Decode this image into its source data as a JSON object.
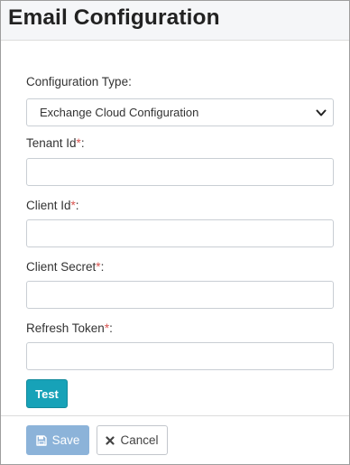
{
  "dialog": {
    "title": "Email Configuration"
  },
  "form": {
    "config_type": {
      "label": "Configuration Type:",
      "selected": "Exchange Cloud Configuration",
      "icon": "chevron-down-icon"
    },
    "tenant_id": {
      "label": "Tenant Id",
      "required_mark": "*",
      "suffix": ":",
      "value": ""
    },
    "client_id": {
      "label": "Client Id",
      "required_mark": "*",
      "suffix": ":",
      "value": ""
    },
    "client_secret": {
      "label": "Client Secret",
      "required_mark": "*",
      "suffix": ":",
      "value": ""
    },
    "refresh_token": {
      "label": "Refresh Token",
      "required_mark": "*",
      "suffix": ":",
      "value": ""
    },
    "test_label": "Test"
  },
  "footer": {
    "save_label": "Save",
    "save_icon": "floppy-disk-icon",
    "cancel_label": "Cancel",
    "cancel_icon": "close-icon"
  },
  "colors": {
    "required": "#d9534f",
    "test_button": "#17a2b8",
    "save_button_disabled": "#8cb3d9",
    "header_bg": "#f5f6f8"
  }
}
